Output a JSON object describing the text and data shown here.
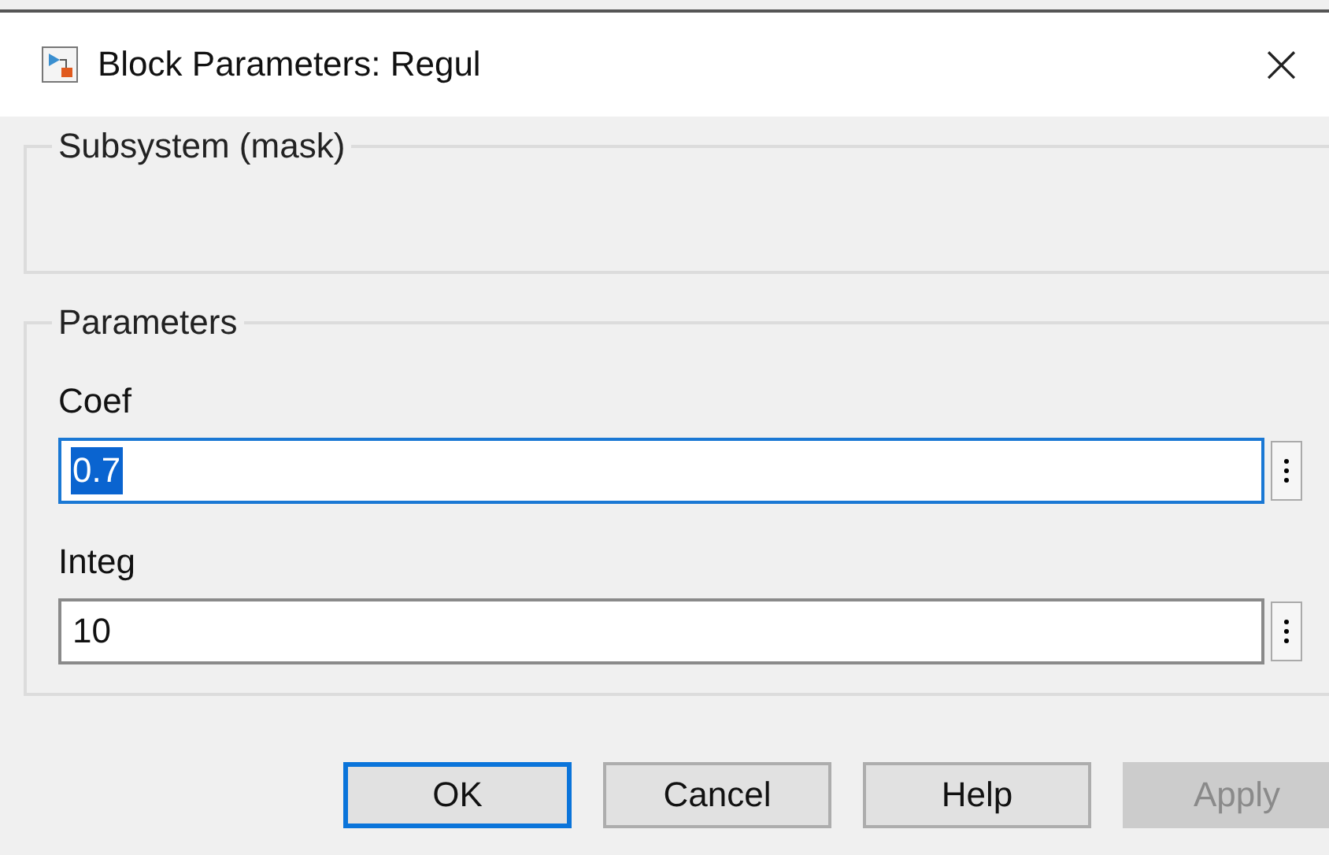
{
  "window": {
    "title": "Block Parameters: Regul",
    "close": "×"
  },
  "groups": [
    {
      "title": "Subsystem (mask)"
    },
    {
      "title": "Parameters",
      "fields": [
        {
          "label": "Coef",
          "value": "0.7",
          "selected": true
        },
        {
          "label": "Integ",
          "value": "10",
          "selected": false
        }
      ]
    }
  ],
  "buttons": [
    {
      "label": "OK",
      "default": true,
      "disabled": false
    },
    {
      "label": "Cancel",
      "default": false,
      "disabled": false
    },
    {
      "label": "Help",
      "default": false,
      "disabled": false
    },
    {
      "label": "Apply",
      "default": false,
      "disabled": true
    }
  ]
}
